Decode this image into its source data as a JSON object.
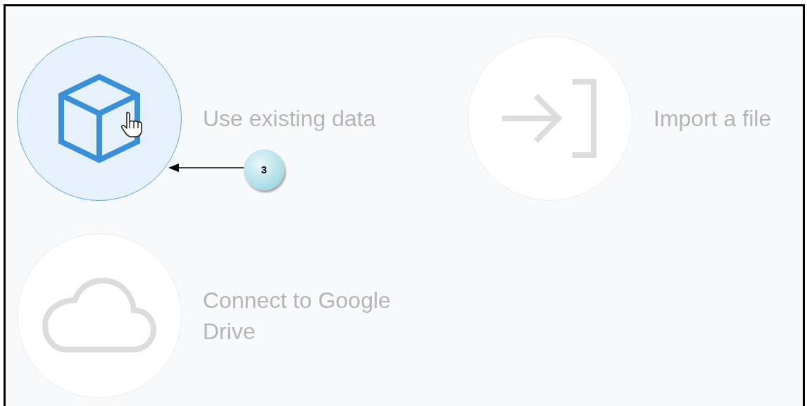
{
  "options": [
    {
      "kind": "cube",
      "label": "Use existing data",
      "selected": true
    },
    {
      "kind": "import",
      "label": "Import a file",
      "selected": false
    },
    {
      "kind": "cloud",
      "label": "Connect to Google Drive",
      "selected": false
    }
  ],
  "callout": {
    "label": "3"
  }
}
